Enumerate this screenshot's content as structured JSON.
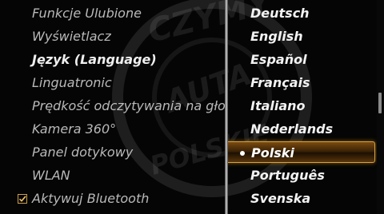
{
  "menu": {
    "items": [
      {
        "label": "Funkcje Ulubione"
      },
      {
        "label": "Wyświetlacz"
      },
      {
        "label": "Język (Language)"
      },
      {
        "label": "Linguatronic"
      },
      {
        "label": "Prędkość odczytywania na głos"
      },
      {
        "label": "Kamera 360°"
      },
      {
        "label": "Panel dotykowy"
      },
      {
        "label": "WLAN"
      },
      {
        "label": "Aktywuj Bluetooth"
      }
    ]
  },
  "languages": {
    "items": [
      {
        "label": "Deutsch"
      },
      {
        "label": "English"
      },
      {
        "label": "Español"
      },
      {
        "label": "Français"
      },
      {
        "label": "Italiano"
      },
      {
        "label": "Nederlands"
      },
      {
        "label": "Polski"
      },
      {
        "label": "Português"
      },
      {
        "label": "Svenska"
      }
    ],
    "selected": "Polski"
  },
  "watermark": {
    "top": "CZYMY",
    "middle": "AUTA",
    "bottom": "POLSKIE"
  },
  "colors": {
    "background": "#050505",
    "menu_text": "#b9b9b9",
    "selection_border": "#d9a23c",
    "selection_fill": "#3c2306"
  }
}
